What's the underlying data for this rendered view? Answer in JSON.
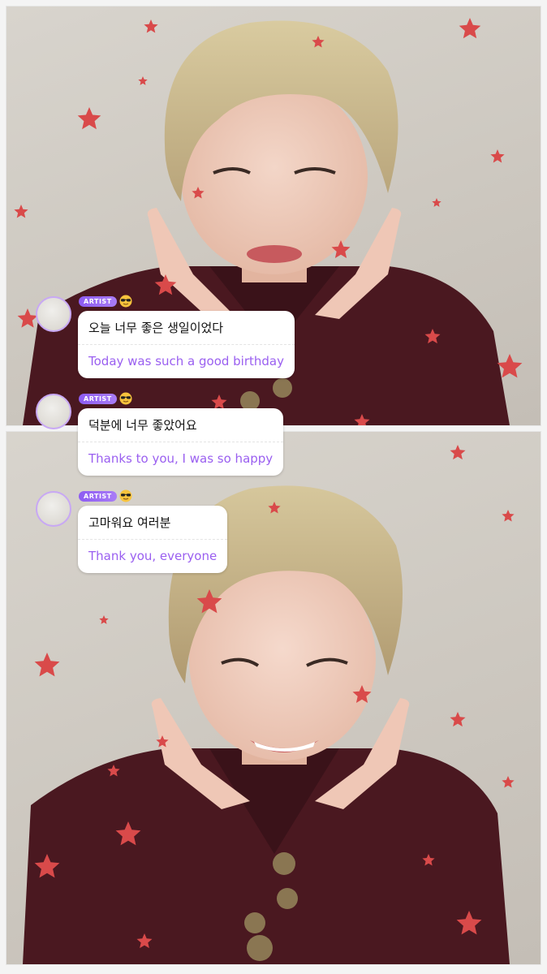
{
  "colors": {
    "badge": "#8d5cf2",
    "translation_text": "#9a5ff0",
    "star": "#d94a4a",
    "jacket": "#4a1820",
    "hair": "#c7b586"
  },
  "messages": [
    {
      "badge": "ARTIST",
      "emoji": "sunglasses-face",
      "original": "오늘 너무 좋은 생일이었다",
      "translation": "Today was such a good birthday"
    },
    {
      "badge": "ARTIST",
      "emoji": "sunglasses-face",
      "original": "덕분에 너무 좋았어요",
      "translation": "Thanks to you, I was so happy"
    },
    {
      "badge": "ARTIST",
      "emoji": "sunglasses-face",
      "original": "고마워요 여러분",
      "translation": "Thank you, everyone"
    }
  ]
}
